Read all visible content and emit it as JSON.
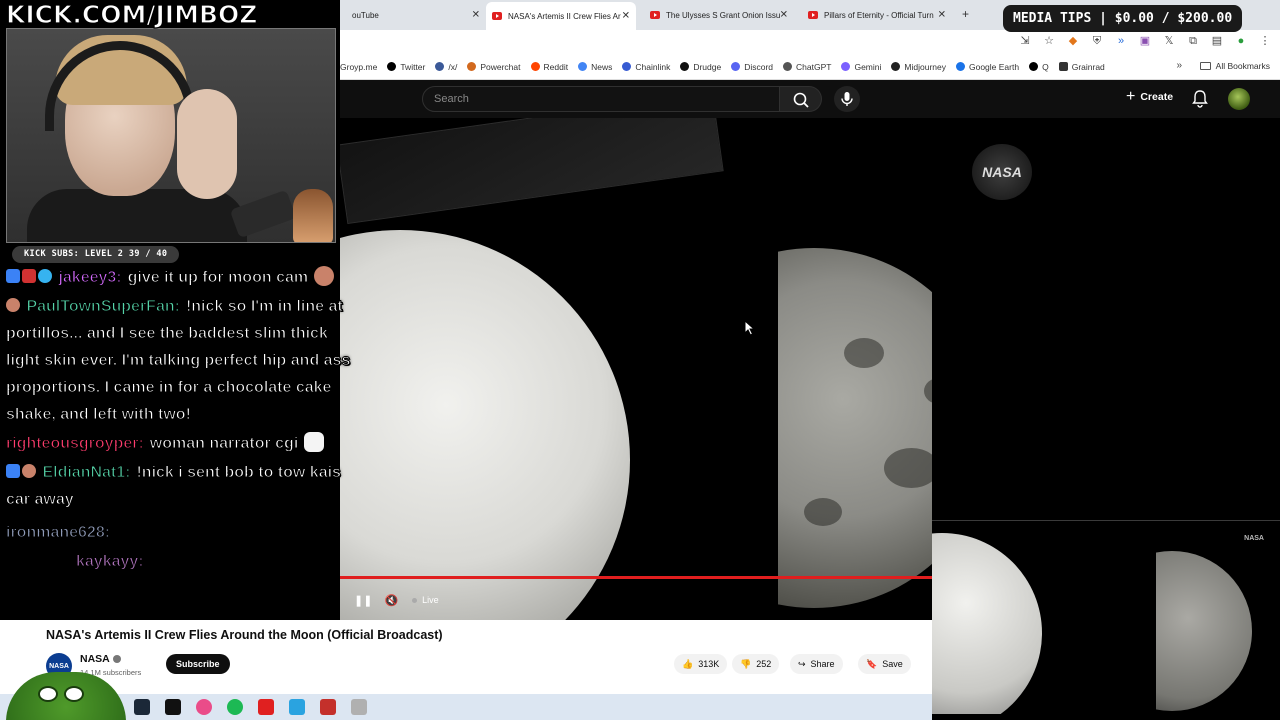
{
  "overlay": {
    "kick_logo": "KICK.COM/JIMBOZ",
    "kick_subs": "KICK SUBS: LEVEL 2 39 / 40",
    "media_tips": "MEDIA TIPS | $0.00 / $200.00"
  },
  "chat": [
    {
      "user": "jakeey3:",
      "user_color": "#d66bff",
      "text": "give it up for moon cam"
    },
    {
      "user": "PaulTownSuperFan:",
      "user_color": "#55d4a9",
      "text": "!nick so I'm in line at portillos... and I see the baddest slim thick light skin ever. I'm talking perfect hip and ass proportions. I came in for a chocolate cake shake, and left with two!"
    },
    {
      "user": "righteousgroyper:",
      "user_color": "#ff3d6e",
      "text": "woman narrator cgi"
    },
    {
      "user": "EldianNat1:",
      "user_color": "#55d4a9",
      "text": "!nick i sent bob to tow kais car away"
    },
    {
      "user": "ironmane628:",
      "user_color": "#a9b7d9",
      "text": ""
    },
    {
      "user": "kaykayy:",
      "user_color": "#d08ae0",
      "text": ""
    }
  ],
  "browser": {
    "tabs": [
      {
        "label": "ouTube"
      },
      {
        "label": "NASA's Artemis II Crew Flies Ar"
      },
      {
        "label": "The Ulysses S Grant Onion Issu"
      },
      {
        "label": "Pillars of Eternity - Official Turn"
      }
    ],
    "bookmarks": [
      {
        "label": "Groyp.me",
        "color": "#6b8e23"
      },
      {
        "label": "Twitter",
        "color": "#000000"
      },
      {
        "label": "/x/",
        "color": "#3b5998"
      },
      {
        "label": "Powerchat",
        "color": "#d2691e"
      },
      {
        "label": "Reddit",
        "color": "#ff4500"
      },
      {
        "label": "News",
        "color": "#4285f4"
      },
      {
        "label": "Chainlink",
        "color": "#375bd2"
      },
      {
        "label": "Drudge",
        "color": "#111111"
      },
      {
        "label": "Discord",
        "color": "#5865f2"
      },
      {
        "label": "ChatGPT",
        "color": "#555555"
      },
      {
        "label": "Gemini",
        "color": "#7b61ff"
      },
      {
        "label": "Midjourney",
        "color": "#222222"
      },
      {
        "label": "Google Earth",
        "color": "#1a73e8"
      },
      {
        "label": "Q",
        "color": "#000000"
      },
      {
        "label": "Grainrad",
        "color": "#333333"
      }
    ],
    "all_bookmarks": "All Bookmarks"
  },
  "youtube": {
    "search_placeholder": "Search",
    "create_label": "Create",
    "video": {
      "title": "NASA's Artemis II Crew Flies Around the Moon (Official Broadcast)",
      "live_label": "Live",
      "logo_text": "NASA",
      "pip_logo_text": "NASA"
    },
    "channel": {
      "name": "NASA",
      "avatar_text": "NASA",
      "subscribers": "14.1M subscribers",
      "subscribe_label": "Subscribe"
    },
    "actions": {
      "likes": "313K",
      "dislikes": "252",
      "share": "Share",
      "save": "Save"
    }
  }
}
